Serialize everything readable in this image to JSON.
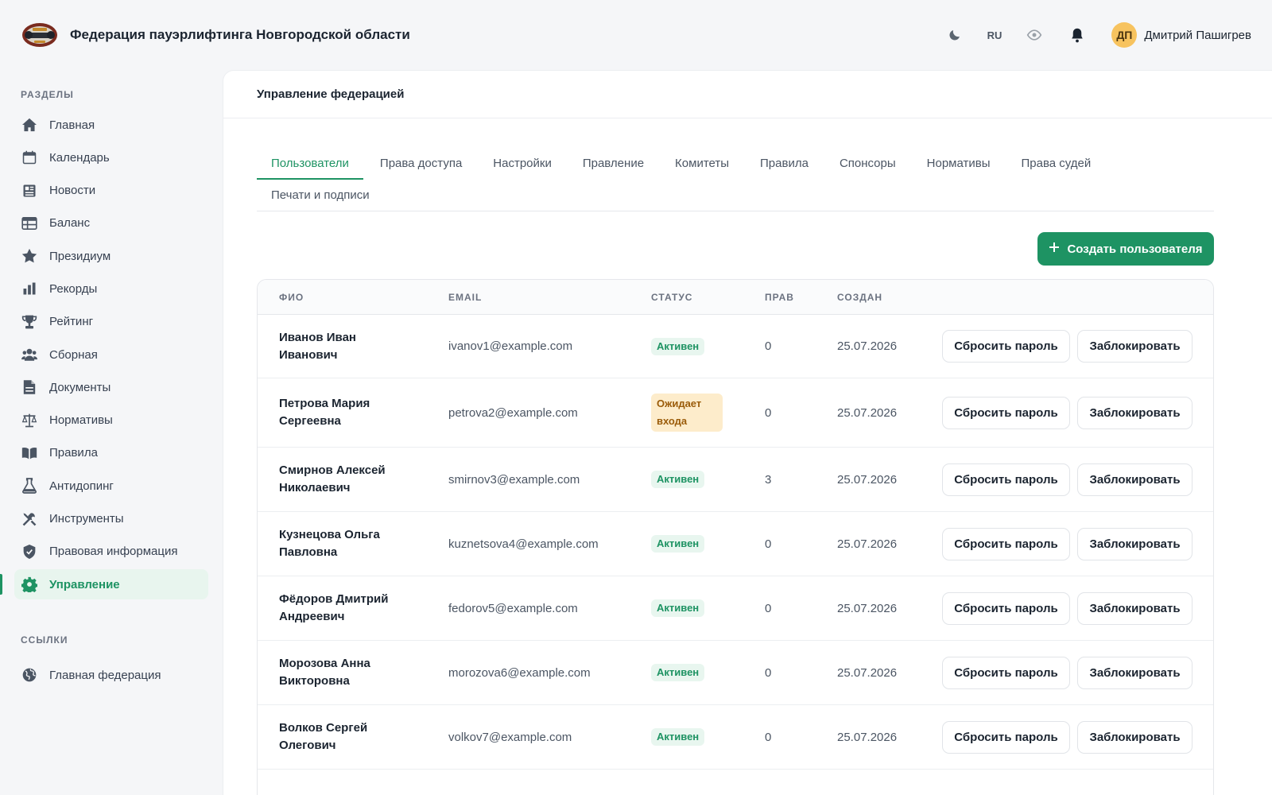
{
  "header": {
    "title": "Федерация пауэрлифтинга Новгородской области",
    "lang": "RU",
    "user_initials": "ДП",
    "user_name": "Дмитрий Пашигрев",
    "icons": [
      "moon-icon",
      "eye-icon",
      "bell-icon"
    ]
  },
  "sidebar": {
    "section_title": "РАЗДЕЛЫ",
    "items": [
      {
        "label": "Главная",
        "icon": "home-icon"
      },
      {
        "label": "Календарь",
        "icon": "calendar-icon"
      },
      {
        "label": "Новости",
        "icon": "news-icon"
      },
      {
        "label": "Баланс",
        "icon": "table-icon"
      },
      {
        "label": "Президиум",
        "icon": "star-icon"
      },
      {
        "label": "Рекорды",
        "icon": "bar-chart-icon"
      },
      {
        "label": "Рейтинг",
        "icon": "trophy-icon"
      },
      {
        "label": "Сборная",
        "icon": "users-icon"
      },
      {
        "label": "Документы",
        "icon": "document-icon"
      },
      {
        "label": "Нормативы",
        "icon": "scales-icon"
      },
      {
        "label": "Правила",
        "icon": "book-icon"
      },
      {
        "label": "Антидопинг",
        "icon": "flask-icon"
      },
      {
        "label": "Инструменты",
        "icon": "tools-icon"
      },
      {
        "label": "Правовая информация",
        "icon": "shield-icon"
      },
      {
        "label": "Управление",
        "icon": "gear-icon",
        "active": true
      }
    ],
    "links_title": "ССЫЛКИ",
    "links": [
      {
        "label": "Главная федерация",
        "icon": "globe-icon"
      }
    ]
  },
  "main": {
    "title": "Управление федерацией",
    "tabs": [
      {
        "label": "Пользователи",
        "active": true
      },
      {
        "label": "Права доступа"
      },
      {
        "label": "Настройки"
      },
      {
        "label": "Правление"
      },
      {
        "label": "Комитеты"
      },
      {
        "label": "Правила"
      },
      {
        "label": "Спонсоры"
      },
      {
        "label": "Нормативы"
      },
      {
        "label": "Права судей"
      },
      {
        "label": "Печати и подписи"
      }
    ],
    "create_button": "Создать пользователя"
  },
  "table": {
    "columns": [
      "ФИО",
      "EMAIL",
      "СТАТУС",
      "ПРАВ",
      "СОЗДАН"
    ],
    "reset_label": "Сбросить пароль",
    "block_label": "Заблокировать",
    "rows": [
      {
        "name": "Иванов Иван Иванович",
        "email": "ivanov1@example.com",
        "status": "Активен",
        "status_type": "active",
        "rights": "0",
        "created": "25.07.2026"
      },
      {
        "name": "Петрова Мария Сергеевна",
        "email": "petrova2@example.com",
        "status": "Ожидает входа",
        "status_type": "pending",
        "rights": "0",
        "created": "25.07.2026"
      },
      {
        "name": "Смирнов Алексей Николаевич",
        "email": "smirnov3@example.com",
        "status": "Активен",
        "status_type": "active",
        "rights": "3",
        "created": "25.07.2026"
      },
      {
        "name": "Кузнецова Ольга Павловна",
        "email": "kuznetsova4@example.com",
        "status": "Активен",
        "status_type": "active",
        "rights": "0",
        "created": "25.07.2026"
      },
      {
        "name": "Фёдоров Дмитрий Андреевич",
        "email": "fedorov5@example.com",
        "status": "Активен",
        "status_type": "active",
        "rights": "0",
        "created": "25.07.2026"
      },
      {
        "name": "Морозова Анна Викторовна",
        "email": "morozova6@example.com",
        "status": "Активен",
        "status_type": "active",
        "rights": "0",
        "created": "25.07.2026"
      },
      {
        "name": "Волков Сергей Олегович",
        "email": "volkov7@example.com",
        "status": "Активен",
        "status_type": "active",
        "rights": "0",
        "created": "25.07.2026"
      }
    ]
  },
  "colors": {
    "accent": "#1e9363",
    "active_badge_bg": "#e8f6ef",
    "pending_badge_bg": "#fdeccb",
    "pending_badge_text": "#9a5b09",
    "avatar_bg": "#f7c35f"
  }
}
